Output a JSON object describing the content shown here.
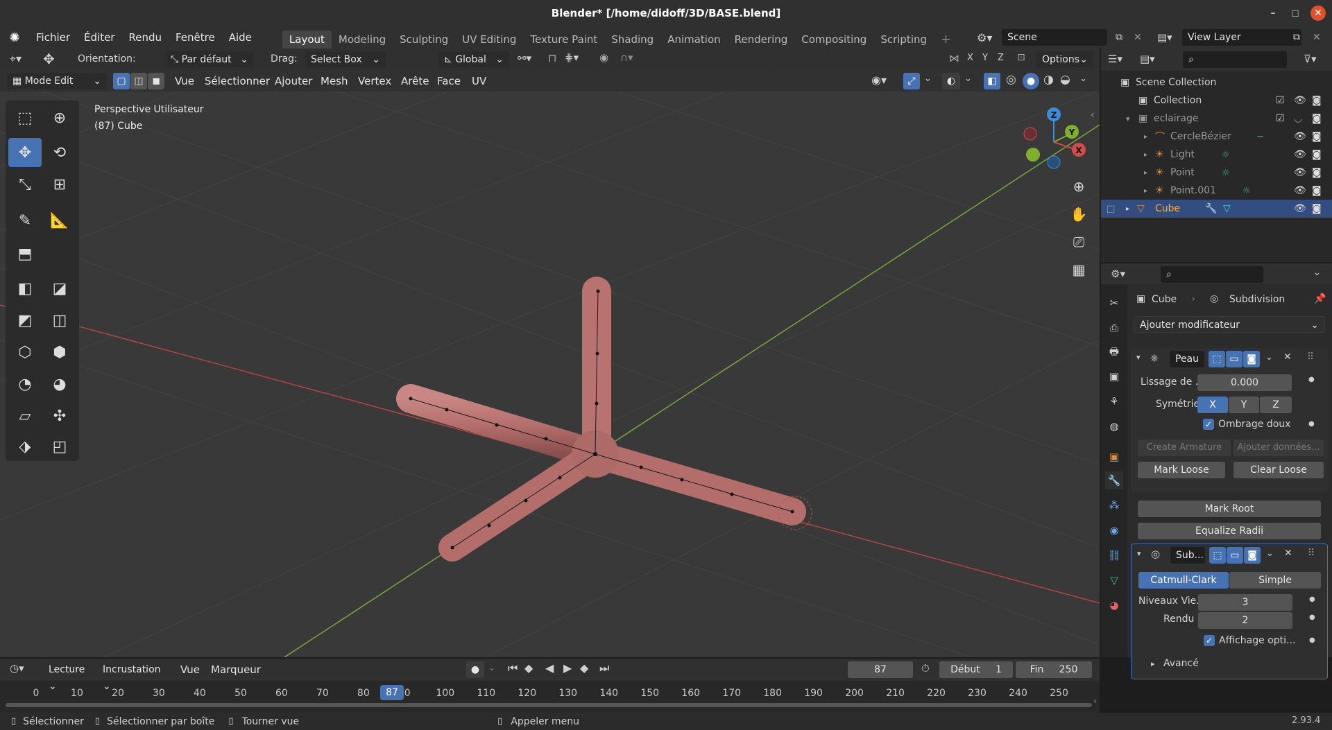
{
  "window": {
    "title": "Blender* [/home/didoff/3D/BASE.blend]",
    "minimize": "–",
    "maximize": "◻",
    "close": "✕"
  },
  "menus": [
    "Fichier",
    "Éditer",
    "Rendu",
    "Fenêtre",
    "Aide"
  ],
  "workspaces": [
    "Layout",
    "Modeling",
    "Sculpting",
    "UV Editing",
    "Texture Paint",
    "Shading",
    "Animation",
    "Rendering",
    "Compositing",
    "Scripting"
  ],
  "active_workspace": "Layout",
  "scene": {
    "name": "Scene",
    "view_layer": "View Layer"
  },
  "tool_header": {
    "orientation_label": "Orientation:",
    "orientation_value": "Par défaut",
    "drag_label": "Drag:",
    "drag_value": "Select Box",
    "transform_orientation": "Global",
    "axes": [
      "X",
      "Y",
      "Z"
    ],
    "options": "Options"
  },
  "view_header": {
    "mode": "Mode Edit",
    "items": [
      "Vue",
      "Sélectionner",
      "Ajouter",
      "Mesh",
      "Vertex",
      "Arête",
      "Face",
      "UV"
    ]
  },
  "viewport": {
    "perspective": "Perspective Utilisateur",
    "object_info": "(87) Cube"
  },
  "gizmo": {
    "x": "X",
    "y": "Y",
    "z": "Z"
  },
  "outliner": {
    "root": "Scene Collection",
    "items": [
      {
        "name": "Collection",
        "depth": 1
      },
      {
        "name": "eclairage",
        "depth": 1
      },
      {
        "name": "CercleBézier",
        "depth": 2
      },
      {
        "name": "Light",
        "depth": 2
      },
      {
        "name": "Point",
        "depth": 2
      },
      {
        "name": "Point.001",
        "depth": 2
      },
      {
        "name": "Cube",
        "depth": 1,
        "selected": true
      }
    ]
  },
  "properties": {
    "breadcrumb_object": "Cube",
    "breadcrumb_modifier": "Subdivision",
    "add_modifier": "Ajouter modificateur",
    "skin": {
      "name": "Peau",
      "smooth_label": "Lissage de ...",
      "smooth_value": "0.000",
      "symmetry_label": "Symétrie",
      "sym_axes": [
        "X",
        "Y",
        "Z"
      ],
      "smooth_shading": "Ombrage doux",
      "create_armature": "Create Armature",
      "add_data": "Ajouter données...",
      "mark_loose": "Mark Loose",
      "clear_loose": "Clear Loose",
      "mark_root": "Mark Root",
      "equalize": "Equalize Radii"
    },
    "subsurf": {
      "name": "Sub...",
      "catmull": "Catmull-Clark",
      "simple": "Simple",
      "levels_label": "Niveaux Vie...",
      "levels_value": "3",
      "render_label": "Rendu",
      "render_value": "2",
      "optimal": "Affichage opti...",
      "advanced": "Avancé"
    }
  },
  "timeline": {
    "playback": "Lecture",
    "keying": "Incrustation",
    "view": "Vue",
    "marker": "Marqueur",
    "current_frame": "87",
    "start_label": "Début",
    "start": "1",
    "end_label": "Fin",
    "end": "250",
    "ticks": [
      "0",
      "10",
      "20",
      "30",
      "40",
      "50",
      "60",
      "70",
      "80",
      "90",
      "100",
      "110",
      "120",
      "130",
      "140",
      "150",
      "160",
      "170",
      "180",
      "190",
      "200",
      "210",
      "220",
      "230",
      "240",
      "250"
    ],
    "playhead": "87"
  },
  "status": {
    "select": "Sélectionner",
    "box_select": "Sélectionner par boîte",
    "rotate": "Tourner vue",
    "menu": "Appeler menu",
    "version": "2.93.4"
  },
  "colors": {
    "accent": "#4772b3",
    "mesh": "#b7716f",
    "x_axis": "#d44a4a",
    "y_axis": "#7eb02e"
  }
}
